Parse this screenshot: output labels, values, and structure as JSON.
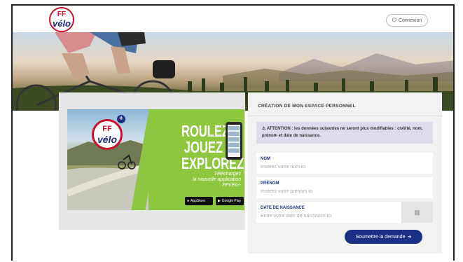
{
  "brand": {
    "logo_top": "FF",
    "logo_bottom": "vélo"
  },
  "header": {
    "login_label": "Connexion",
    "login_icon": "power-icon"
  },
  "promo": {
    "slogan": [
      "ROULEZ",
      "JOUEZ",
      "EXPLOREZ"
    ],
    "download_line1": "Téléchargez",
    "download_line2": "la nouvelle application",
    "download_line3": "FFVélo+",
    "appstore_label": "AppStore",
    "playstore_label": "Google Play"
  },
  "form": {
    "title": "CRÉATION DE MON ESPACE PERSONNEL",
    "alert": "ATTENTION : les données suivantes ne seront plus modifiables : civilité, nom, prénom et date de naissance.",
    "fields": {
      "nom": {
        "label": "NOM",
        "placeholder": "Insérez votre nom ici"
      },
      "prenom": {
        "label": "PRÉNOM",
        "placeholder": "Insérez votre prénom ici"
      },
      "date": {
        "label": "DATE DE NAISSANCE",
        "placeholder": "Entre votre date de naissance ici"
      }
    },
    "submit_label": "Soumettre la demande"
  },
  "colors": {
    "brand_red": "#c8102e",
    "brand_navy": "#1c2f86",
    "promo_green": "#8dc63f"
  }
}
